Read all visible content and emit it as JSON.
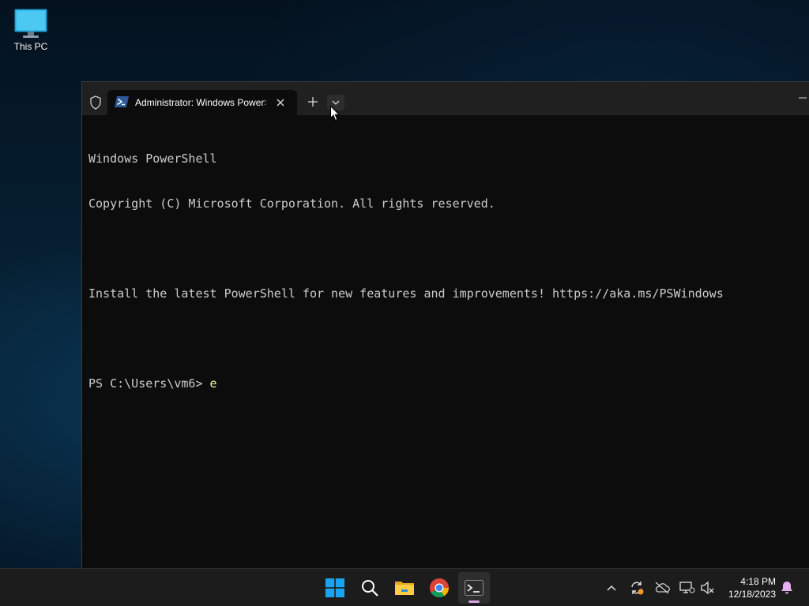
{
  "desktop": {
    "icons": [
      {
        "label": "This PC",
        "icon": "monitor-icon"
      }
    ]
  },
  "terminal": {
    "tab_title": "Administrator: Windows PowerShell",
    "tab_icon": "powershell-icon",
    "console_lines": [
      "Windows PowerShell",
      "Copyright (C) Microsoft Corporation. All rights reserved.",
      "",
      "Install the latest PowerShell for new features and improvements! https://aka.ms/PSWindows",
      "",
      "PS C:\\Users\\vm6> "
    ],
    "typed_input": "e"
  },
  "taskbar": {
    "apps": [
      {
        "name": "Start",
        "icon": "windows-logo-icon"
      },
      {
        "name": "Search",
        "icon": "search-icon"
      },
      {
        "name": "File Explorer",
        "icon": "folder-icon"
      },
      {
        "name": "Google Chrome",
        "icon": "chrome-icon"
      },
      {
        "name": "Terminal",
        "icon": "terminal-icon",
        "active": true
      }
    ],
    "tray_icons": [
      "chevron-up-icon",
      "sync-icon",
      "cloud-off-icon",
      "network-icon",
      "volume-muted-icon"
    ],
    "clock": {
      "time": "4:18 PM",
      "date": "12/18/2023"
    }
  },
  "colors": {
    "console_bg": "#0c0c0c",
    "console_fg": "#cccccc",
    "typed_fg": "#f2f2a6",
    "titlebar_bg": "#202020",
    "taskbar_bg": "#1c1c1c",
    "accent_blue": "#0078d4",
    "notification": "#d8a4e6"
  }
}
